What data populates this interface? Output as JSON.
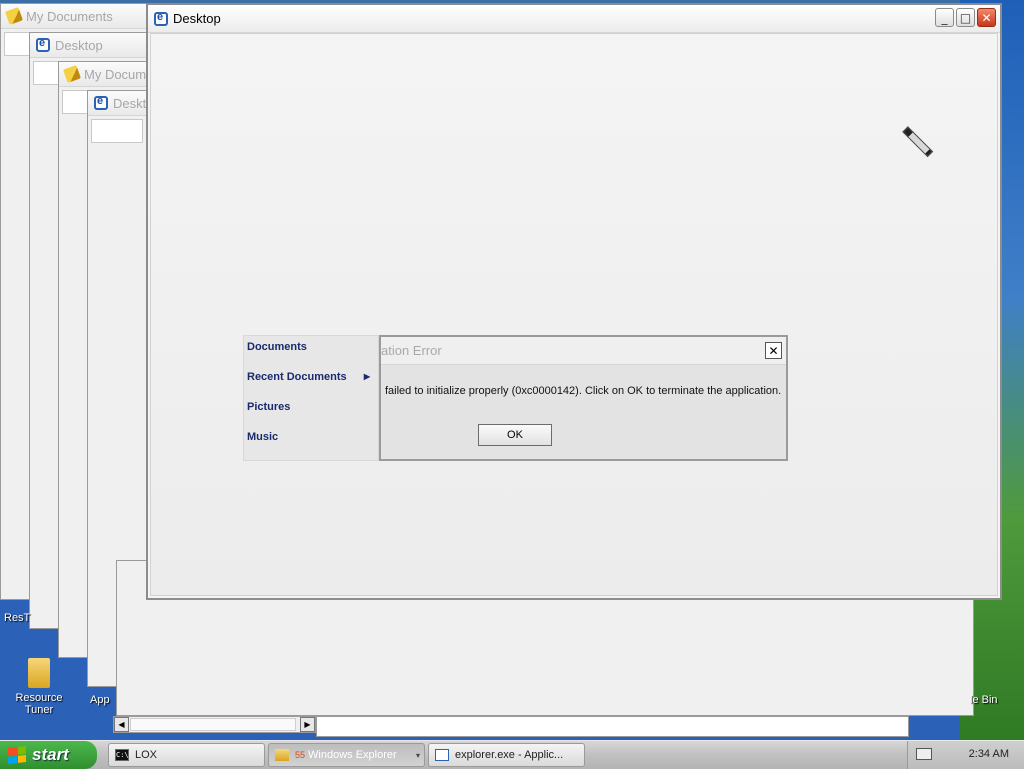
{
  "background_windows": [
    {
      "title": "My Documents",
      "icon": "pencil-icon"
    },
    {
      "title": "Desktop",
      "icon": "ie-icon"
    },
    {
      "title": "My Docum",
      "icon": "pencil-icon"
    },
    {
      "title": "Deskt",
      "icon": "ie-icon"
    }
  ],
  "main_window": {
    "title": "Desktop",
    "buttons": {
      "minimize": "_",
      "maximize": "□",
      "close": "✕"
    }
  },
  "start_menu_fragment": {
    "items": [
      {
        "label": "Documents"
      },
      {
        "label": "Recent Documents",
        "has_submenu": true
      },
      {
        "label": "Pictures"
      },
      {
        "label": "Music"
      }
    ]
  },
  "error_dialog": {
    "title": "ation Error",
    "close": "✕",
    "message": " failed to initialize properly (0xc0000142). Click on OK to terminate the application.",
    "ok_label": "OK"
  },
  "desktop_icons": [
    {
      "label_line1": "Resource",
      "label_line2": "Tuner"
    },
    {
      "label_line1": "App",
      "label_line2": ""
    },
    {
      "label_line1": "ResT",
      "label_line2": ""
    },
    {
      "label_line1": "le Bin",
      "label_line2": ""
    }
  ],
  "taskbar": {
    "start_label": "start",
    "items": [
      {
        "label": "LOX",
        "icon": "cmd-icon",
        "active": false
      },
      {
        "label": "Windows Explorer",
        "icon": "folder-icon",
        "active": true,
        "count": "55"
      },
      {
        "label": "explorer.exe - Applic...",
        "icon": "app-window-icon",
        "active": false
      }
    ],
    "clock": "2:34 AM"
  },
  "colors": {
    "dialog_bg": "#e3e3e3",
    "menu_text": "#1a2a6c",
    "start_green": "#3a9e3a",
    "taskbar": "#c8c8c8"
  }
}
